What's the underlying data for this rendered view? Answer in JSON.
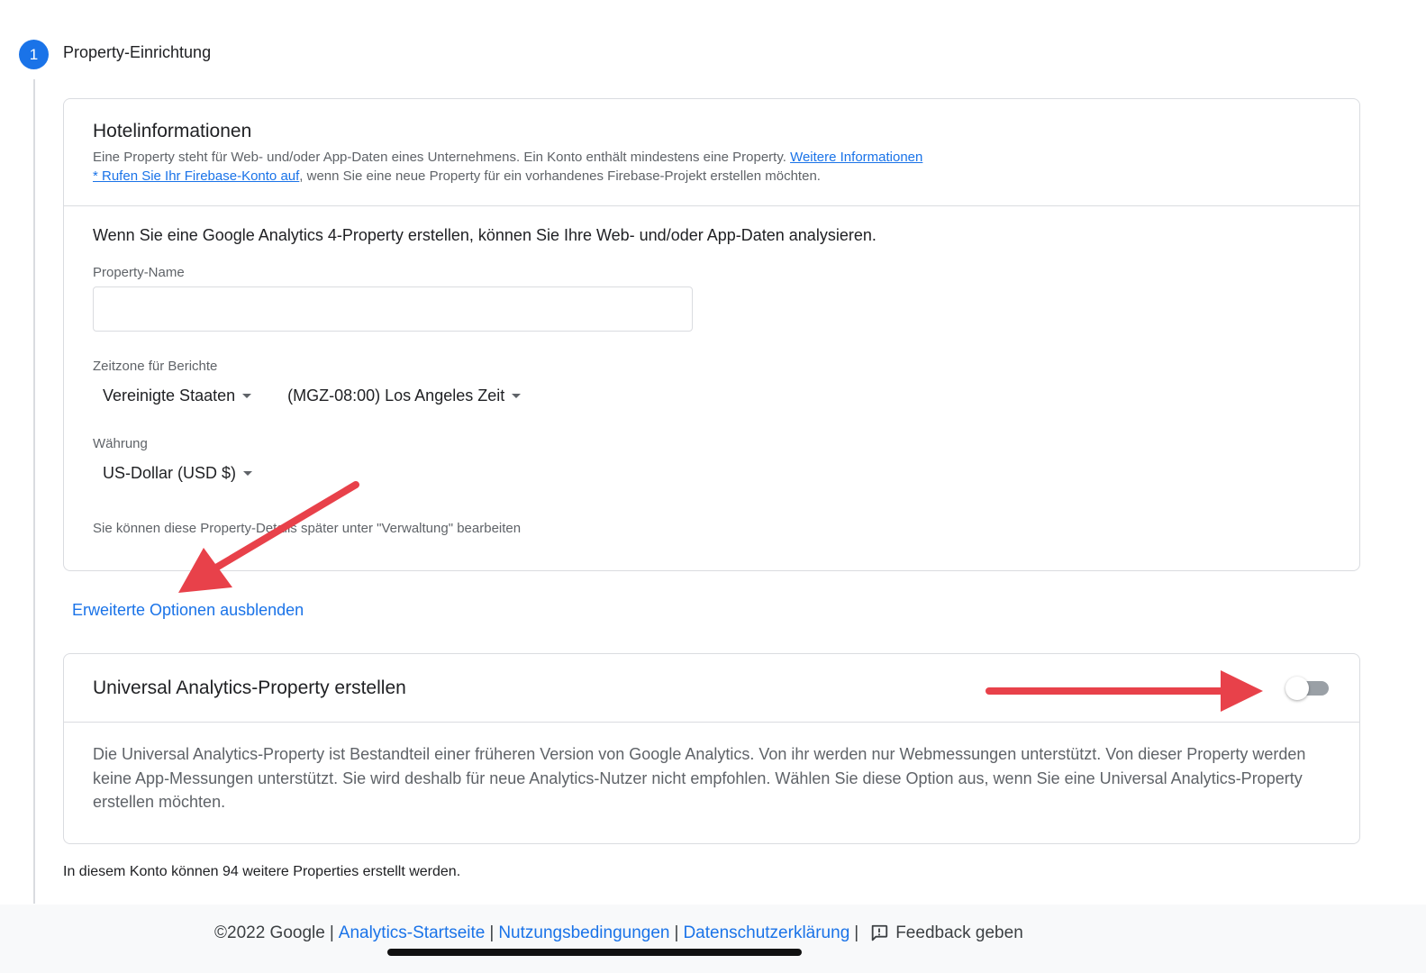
{
  "step": {
    "number": "1",
    "title": "Property-Einrichtung"
  },
  "hotel_card": {
    "title": "Hotelinformationen",
    "help_text_1": "Eine Property steht für Web- und/oder App-Daten eines Unternehmens. Ein Konto enthält mindestens eine Property.",
    "help_link_1": "Weitere Informationen",
    "help_link_2": "* Rufen Sie Ihr Firebase-Konto auf",
    "help_text_2": ", wenn Sie eine neue Property für ein vorhandenes Firebase-Projekt erstellen möchten.",
    "intro": "Wenn Sie eine Google Analytics 4-Property erstellen, können Sie Ihre Web- und/oder App-Daten analysieren.",
    "property_name_label": "Property-Name",
    "property_name_value": "",
    "timezone_label": "Zeitzone für Berichte",
    "timezone_country": "Vereinigte Staaten",
    "timezone_value": "(MGZ-08:00) Los Angeles Zeit",
    "currency_label": "Währung",
    "currency_value": "US-Dollar (USD $)",
    "footnote": "Sie können diese Property-Details später unter \"Verwaltung\" bearbeiten"
  },
  "advanced_link": "Erweiterte Optionen ausblenden",
  "ua_card": {
    "title": "Universal Analytics-Property erstellen",
    "toggle_on": false,
    "description": "Die Universal Analytics-Property ist Bestandteil einer früheren Version von Google Analytics. Von ihr werden nur Webmessungen unterstützt. Von dieser Property werden keine App-Messungen unterstützt. Sie wird deshalb für neue Analytics-Nutzer nicht empfohlen. Wählen Sie diese Option aus, wenn Sie eine Universal Analytics-Property erstellen möchten."
  },
  "quota_text": "In diesem Konto können 94 weitere Properties erstellt werden.",
  "footer": {
    "copyright": "©2022 Google",
    "separator": "|",
    "links": [
      "Analytics-Startseite",
      "Nutzungsbedingungen",
      "Datenschutzerklärung"
    ],
    "feedback": "Feedback geben"
  },
  "colors": {
    "accent": "#1a73e8",
    "annotation_arrow": "#e8414a",
    "border": "#dadce0"
  },
  "icons": [
    "feedback-icon",
    "caret-down-icon"
  ]
}
